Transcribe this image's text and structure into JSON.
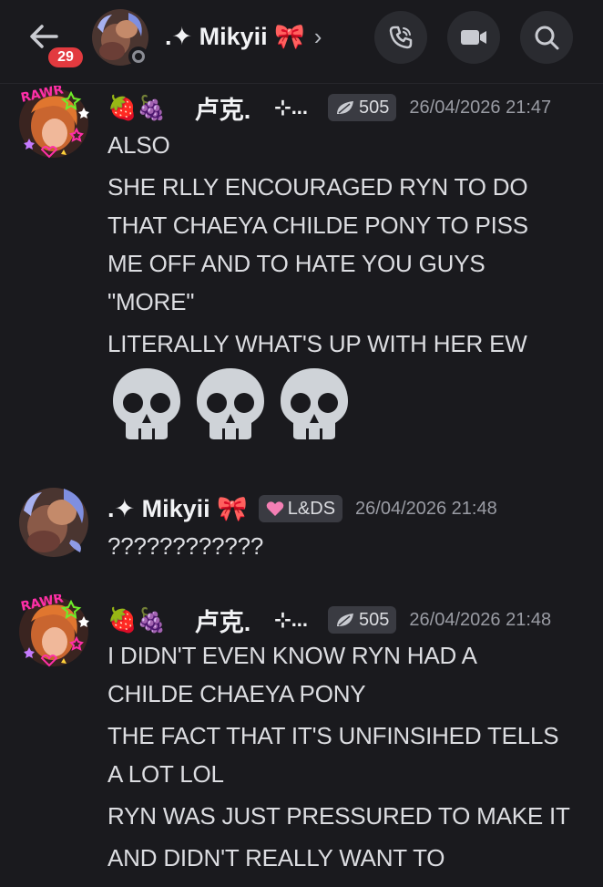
{
  "header": {
    "unread_count": "29",
    "channel_name": ".✦ Mikyii 🎀",
    "chevron": "›"
  },
  "messages": [
    {
      "emojis": "🍓🍇",
      "username": "卢克.",
      "sparkle": "⊹...",
      "tag": "505",
      "timestamp": "26/04/2026 21:47",
      "lines": [
        "ALSO",
        "SHE RLLY ENCOURAGED RYN TO DO",
        "THAT CHAEYA CHILDE PONY TO PISS",
        "ME OFF AND TO HATE YOU GUYS",
        "\"MORE\"",
        "LITERALLY WHAT'S UP WITH HER EW"
      ],
      "emoji_reaction": "💀💀💀"
    },
    {
      "username": ".✦ Mikyii 🎀",
      "tag": "L&DS",
      "tag_icon": "pink-heart-icon",
      "timestamp": "26/04/2026 21:48",
      "lines": [
        "????????????"
      ]
    },
    {
      "emojis": "🍓🍇",
      "username": "卢克.",
      "sparkle": "⊹...",
      "tag": "505",
      "timestamp": "26/04/2026 21:48",
      "lines": [
        "I DIDN'T EVEN KNOW RYN HAD A",
        "CHILDE CHAEYA PONY",
        "THE FACT THAT IT'S UNFINSIHED TELLS",
        "A LOT LOL",
        "RYN WAS JUST PRESSURED TO MAKE IT",
        "AND DIDN'T REALLY WANT TO"
      ]
    }
  ],
  "colors": {
    "background": "#1a1a1e",
    "badge": "#e23a3f",
    "tag_bg": "#3a3b42",
    "timestamp": "#9a9ca4"
  }
}
